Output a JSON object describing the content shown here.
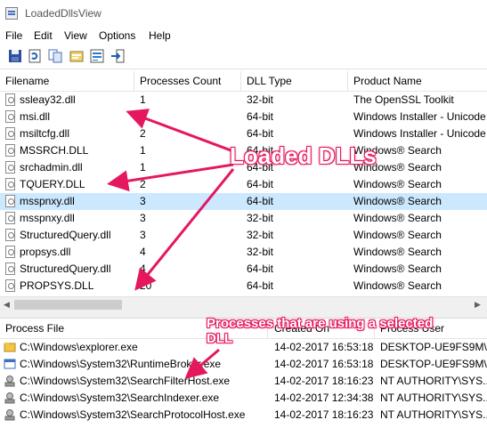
{
  "window": {
    "title": "LoadedDllsView"
  },
  "menu": [
    "File",
    "Edit",
    "View",
    "Options",
    "Help"
  ],
  "toolbar": [
    {
      "icon": "save-icon"
    },
    {
      "icon": "refresh-icon"
    },
    {
      "icon": "copy-icon"
    },
    {
      "icon": "properties-icon"
    },
    {
      "icon": "html-report-icon"
    },
    {
      "icon": "exit-icon"
    }
  ],
  "dll_list": {
    "columns": [
      "Filename",
      "Processes Count",
      "DLL Type",
      "Product Name"
    ],
    "rows": [
      {
        "filename": "ssleay32.dll",
        "count": "1",
        "type": "32-bit",
        "product": "The OpenSSL Toolkit"
      },
      {
        "filename": "msi.dll",
        "count": "1",
        "type": "64-bit",
        "product": "Windows Installer - Unicode"
      },
      {
        "filename": "msiltcfg.dll",
        "count": "2",
        "type": "64-bit",
        "product": "Windows Installer - Unicode"
      },
      {
        "filename": "MSSRCH.DLL",
        "count": "1",
        "type": "64-bit",
        "product": "Windows® Search"
      },
      {
        "filename": "srchadmin.dll",
        "count": "1",
        "type": "64-bit",
        "product": "Windows® Search"
      },
      {
        "filename": "TQUERY.DLL",
        "count": "2",
        "type": "64-bit",
        "product": "Windows® Search"
      },
      {
        "filename": "msspnxy.dll",
        "count": "3",
        "type": "64-bit",
        "product": "Windows® Search",
        "selected": true
      },
      {
        "filename": "msspnxy.dll",
        "count": "3",
        "type": "32-bit",
        "product": "Windows® Search"
      },
      {
        "filename": "StructuredQuery.dll",
        "count": "3",
        "type": "32-bit",
        "product": "Windows® Search"
      },
      {
        "filename": "propsys.dll",
        "count": "4",
        "type": "32-bit",
        "product": "Windows® Search"
      },
      {
        "filename": "StructuredQuery.dll",
        "count": "4",
        "type": "64-bit",
        "product": "Windows® Search"
      },
      {
        "filename": "PROPSYS.DLL",
        "count": "20",
        "type": "64-bit",
        "product": "Windows® Search"
      }
    ]
  },
  "process_list": {
    "columns": [
      "Process File",
      "Created On",
      "Process User"
    ],
    "rows": [
      {
        "file": "C:\\Windows\\explorer.exe",
        "created": "14-02-2017 16:53:18",
        "user": "DESKTOP-UE9FS9M\\...",
        "icon": "explorer-icon"
      },
      {
        "file": "C:\\Windows\\System32\\RuntimeBroker.exe",
        "created": "14-02-2017 16:53:18",
        "user": "DESKTOP-UE9FS9M\\...",
        "icon": "window-icon"
      },
      {
        "file": "C:\\Windows\\System32\\SearchFilterHost.exe",
        "created": "14-02-2017 18:16:23",
        "user": "NT AUTHORITY\\SYS...",
        "icon": "search-process-icon"
      },
      {
        "file": "C:\\Windows\\System32\\SearchIndexer.exe",
        "created": "14-02-2017 12:34:38",
        "user": "NT AUTHORITY\\SYS...",
        "icon": "search-process-icon"
      },
      {
        "file": "C:\\Windows\\System32\\SearchProtocolHost.exe",
        "created": "14-02-2017 18:16:23",
        "user": "NT AUTHORITY\\SYS...",
        "icon": "search-process-icon"
      }
    ]
  },
  "annotations": {
    "loaded_dlls": "Loaded DLLs",
    "processes": "Processes that are using a selected DLL"
  },
  "colors": {
    "selection": "#cce8ff",
    "annotation": "#e5175f"
  }
}
